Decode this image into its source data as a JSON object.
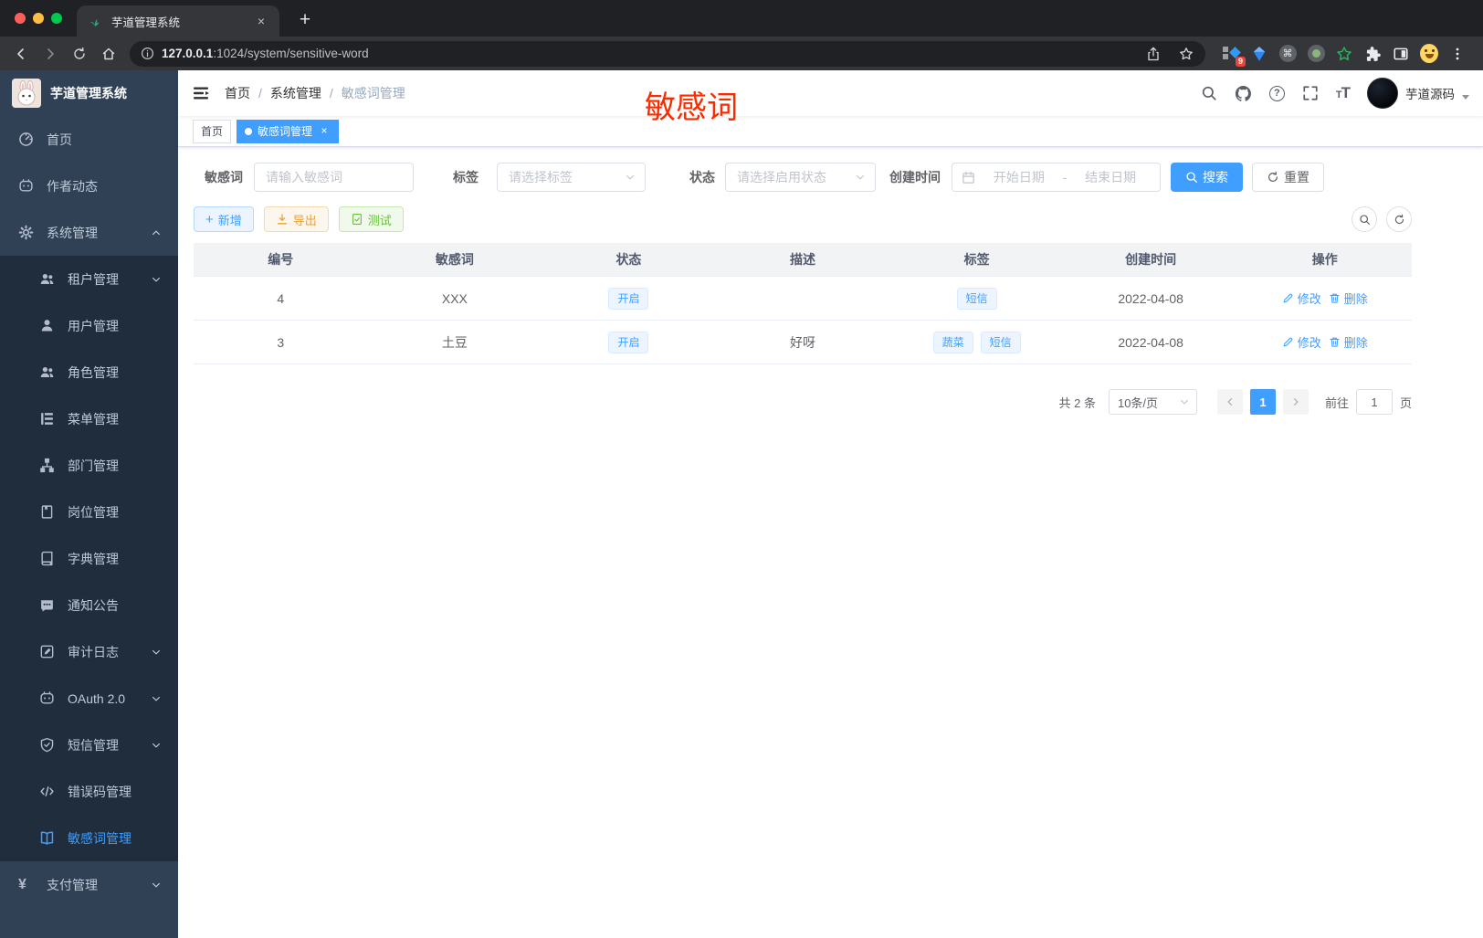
{
  "colors": {
    "accent": "#409eff",
    "sidebar_bg": "#304156",
    "submenu_bg": "#1f2d3d",
    "annotation_red": "#fb2b00",
    "tag_bg": "#ecf5ff",
    "warning": "#e6a23c",
    "success": "#67c23a"
  },
  "browser": {
    "tab": {
      "title": "芋道管理系统",
      "favicon": "plant-icon",
      "close_glyph": "×",
      "new_tab_glyph": "+"
    },
    "url": {
      "secure_part": "127.0.0.1",
      "rest": ":1024/system/sensitive-word"
    },
    "extensions": {
      "badge_count": "9",
      "command_glyph": "⌘",
      "icons": [
        "grid-diamond-extension-icon",
        "blue-gem-extension-icon",
        "command-circle-extension-icon",
        "green-dot-circle-extension-icon",
        "green-star-extension-icon",
        "puzzle-extensions-icon",
        "split-square-icon",
        "profile-emoji-avatar",
        "kebab-menu-icon"
      ]
    }
  },
  "sidebar": {
    "logo_title": "芋道管理系统",
    "items": [
      {
        "label": "首页",
        "icon": "dashboard-icon"
      },
      {
        "label": "作者动态",
        "icon": "author-face-icon"
      },
      {
        "label": "系统管理",
        "icon": "gear-icon",
        "chevron": "up"
      },
      {
        "label": "租户管理",
        "icon": "tenants-icon",
        "chevron": "down"
      },
      {
        "label": "用户管理",
        "icon": "user-icon"
      },
      {
        "label": "角色管理",
        "icon": "roles-icon"
      },
      {
        "label": "菜单管理",
        "icon": "menu-tree-icon"
      },
      {
        "label": "部门管理",
        "icon": "org-tree-icon"
      },
      {
        "label": "岗位管理",
        "icon": "post-badge-icon"
      },
      {
        "label": "字典管理",
        "icon": "dictionary-icon"
      },
      {
        "label": "通知公告",
        "icon": "notice-bubble-icon"
      },
      {
        "label": "审计日志",
        "icon": "audit-log-icon",
        "chevron": "down"
      },
      {
        "label": "OAuth 2.0",
        "icon": "oauth-face-icon",
        "chevron": "down"
      },
      {
        "label": "短信管理",
        "icon": "shield-check-icon",
        "chevron": "down"
      },
      {
        "label": "错误码管理",
        "icon": "code-icon"
      },
      {
        "label": "敏感词管理",
        "icon": "open-book-icon",
        "active": true
      },
      {
        "label": "支付管理",
        "icon": "yen-icon",
        "chevron": "down",
        "yen_glyph": "¥"
      }
    ]
  },
  "navbar": {
    "breadcrumb": {
      "items": [
        "首页",
        "系统管理",
        "敏感词管理"
      ],
      "separator": "/"
    },
    "annotation": "敏感词",
    "user_name": "芋道源码",
    "icons": [
      "search-icon",
      "github-icon",
      "question-icon",
      "fullscreen-icon",
      "font-size-icon"
    ]
  },
  "tags_view": {
    "items": [
      {
        "label": "首页",
        "active": false
      },
      {
        "label": "敏感词管理",
        "active": true,
        "close_glyph": "×"
      }
    ]
  },
  "filters": {
    "keyword_label": "敏感词",
    "keyword_placeholder": "请输入敏感词",
    "tag_label": "标签",
    "tag_placeholder": "请选择标签",
    "status_label": "状态",
    "status_placeholder": "请选择启用状态",
    "date_label": "创建时间",
    "date_start_placeholder": "开始日期",
    "date_separator": "-",
    "date_end_placeholder": "结束日期",
    "search_label": "搜索",
    "reset_label": "重置"
  },
  "toolbar": {
    "add_label": "新增",
    "add_glyph": "+",
    "export_label": "导出",
    "test_label": "测试"
  },
  "table": {
    "columns": [
      "编号",
      "敏感词",
      "状态",
      "描述",
      "标签",
      "创建时间",
      "操作"
    ],
    "edit_label": "修改",
    "delete_label": "删除",
    "rows": [
      {
        "id": "4",
        "word": "XXX",
        "status": "开启",
        "description": "",
        "tags": [
          "短信"
        ],
        "created": "2022-04-08"
      },
      {
        "id": "3",
        "word": "土豆",
        "status": "开启",
        "description": "好呀",
        "tags": [
          "蔬菜",
          "短信"
        ],
        "created": "2022-04-08"
      }
    ]
  },
  "pagination": {
    "total": "共 2 条",
    "page_size": "10条/页",
    "current_page": "1",
    "goto_label": "前往",
    "goto_value": "1",
    "page_unit": "页"
  }
}
